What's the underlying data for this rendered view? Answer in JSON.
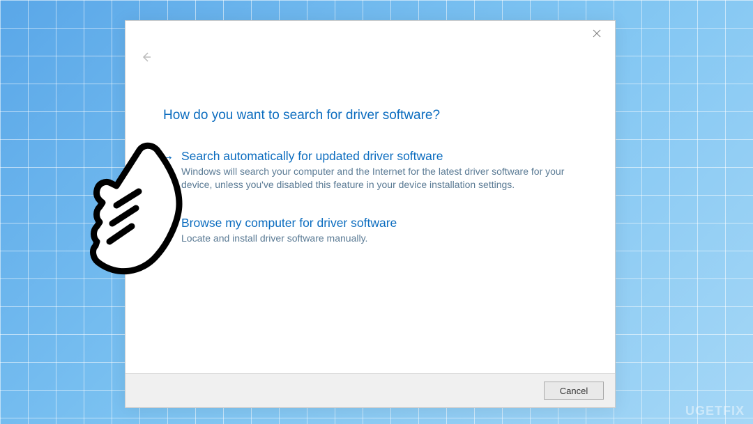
{
  "dialog": {
    "heading": "How do you want to search for driver software?",
    "options": [
      {
        "title": "Search automatically for updated driver software",
        "desc": "Windows will search your computer and the Internet for the latest driver software for your device, unless you've disabled this feature in your device installation settings."
      },
      {
        "title": "Browse my computer for driver software",
        "desc": "Locate and install driver software manually."
      }
    ],
    "cancel_label": "Cancel"
  },
  "watermark": "UGETFIX"
}
